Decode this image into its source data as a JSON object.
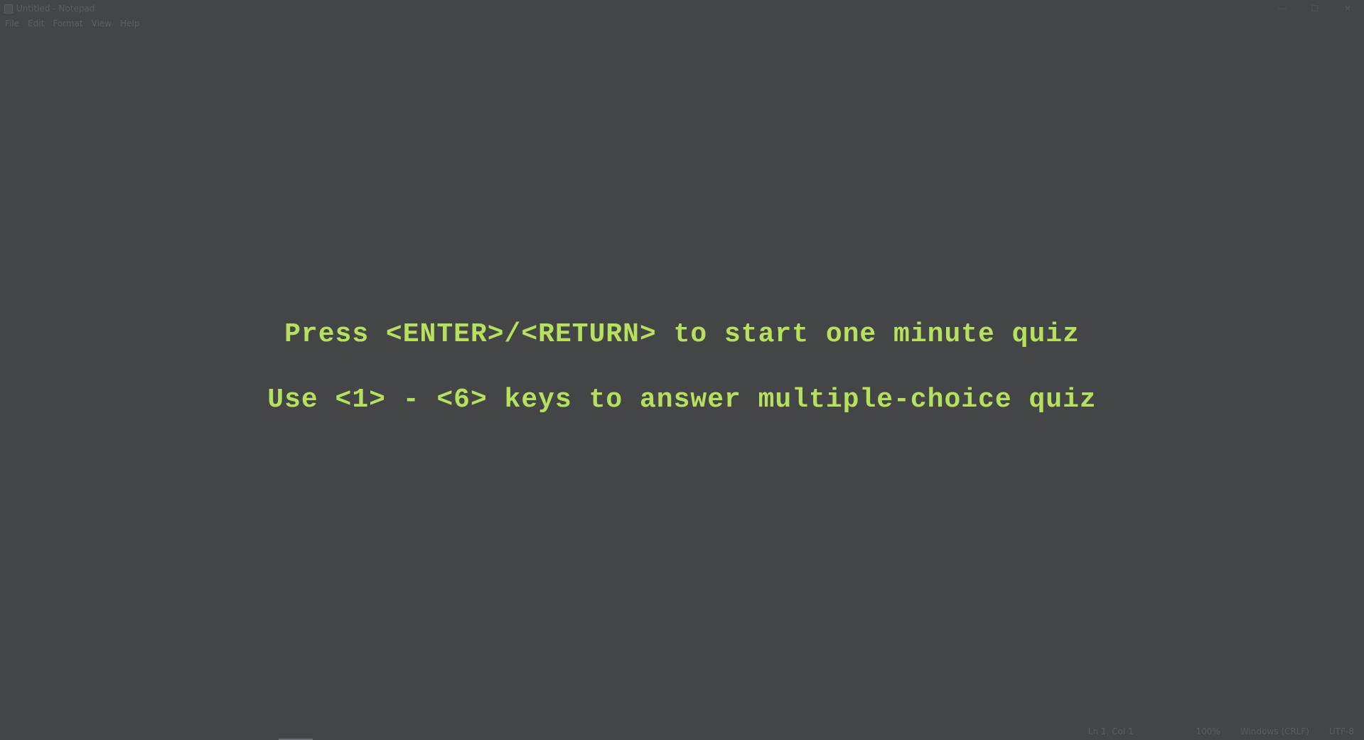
{
  "window": {
    "title": "Untitled - Notepad",
    "controls": {
      "minimize_icon": "—",
      "maximize_icon": "☐",
      "close_icon": "✕"
    }
  },
  "menu": {
    "items": [
      {
        "label": "File"
      },
      {
        "label": "Edit"
      },
      {
        "label": "Format"
      },
      {
        "label": "View"
      },
      {
        "label": "Help"
      }
    ]
  },
  "editor": {
    "lines": [
      "Press <ENTER>/<RETURN> to start one minute quiz",
      "Use <1> - <6> keys to answer multiple-choice quiz"
    ],
    "text_color": "#b6e05e",
    "background_color": "#444547"
  },
  "status": {
    "position": "Ln 1, Col 1",
    "zoom": "100%",
    "line_ending": "Windows (CRLF)",
    "encoding": "UTF-8"
  }
}
